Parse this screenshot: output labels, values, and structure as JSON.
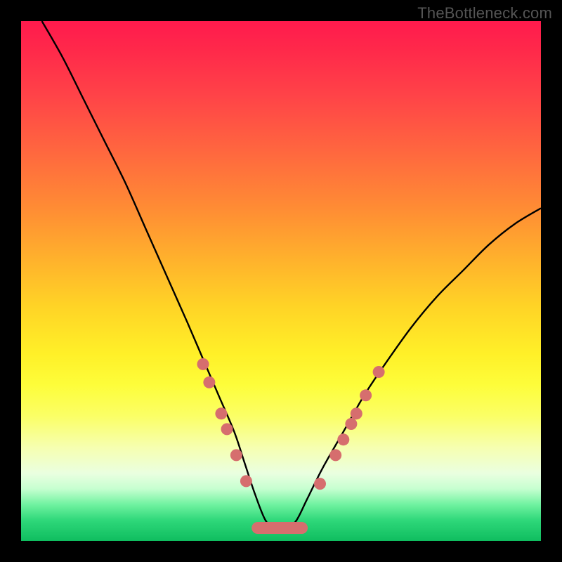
{
  "watermark": "TheBottleneck.com",
  "colors": {
    "frame": "#000000",
    "gradient_top": "#ff1a4d",
    "gradient_bottom": "#0fbd5f",
    "curve": "#000000",
    "marker": "#d66e6e"
  },
  "chart_data": {
    "type": "line",
    "title": "",
    "xlabel": "",
    "ylabel": "",
    "xlim": [
      0,
      100
    ],
    "ylim": [
      0,
      100
    ],
    "annotations": [
      "TheBottleneck.com"
    ],
    "description": "Single V-shaped bottleneck curve over a vertical red-to-green gradient. Curve descends from top-left, bottoms out with a flat minimum around x≈47–53 at y≈2, then rises toward the right edge reaching y≈64 at x=100. Salmon markers cluster on the descending and ascending limbs near the bottom (mid-y range) and form a flat row along the minimum.",
    "series": [
      {
        "name": "bottleneck-curve",
        "x": [
          4,
          8,
          12,
          16,
          20,
          24,
          28,
          32,
          35,
          38,
          41,
          43,
          45,
          47,
          49,
          51,
          53,
          55,
          58,
          62,
          66,
          70,
          75,
          80,
          85,
          90,
          95,
          100
        ],
        "y": [
          100,
          93,
          85,
          77,
          69,
          60,
          51,
          42,
          35,
          28,
          21,
          15,
          9,
          4,
          2,
          2,
          4,
          8,
          14,
          21,
          28,
          34,
          41,
          47,
          52,
          57,
          61,
          64
        ]
      }
    ],
    "markers_left": [
      {
        "x": 35.0,
        "y": 34.0
      },
      {
        "x": 36.2,
        "y": 30.5
      },
      {
        "x": 38.5,
        "y": 24.5
      },
      {
        "x": 39.6,
        "y": 21.5
      },
      {
        "x": 41.4,
        "y": 16.5
      },
      {
        "x": 43.3,
        "y": 11.5
      }
    ],
    "markers_right": [
      {
        "x": 57.5,
        "y": 11.0
      },
      {
        "x": 60.5,
        "y": 16.5
      },
      {
        "x": 62.0,
        "y": 19.5
      },
      {
        "x": 63.5,
        "y": 22.5
      },
      {
        "x": 64.5,
        "y": 24.5
      },
      {
        "x": 66.3,
        "y": 28.0
      },
      {
        "x": 68.8,
        "y": 32.5
      }
    ],
    "markers_bottom_pill": [
      {
        "x0": 45.5,
        "x1": 54.0,
        "y": 2.5
      }
    ]
  }
}
